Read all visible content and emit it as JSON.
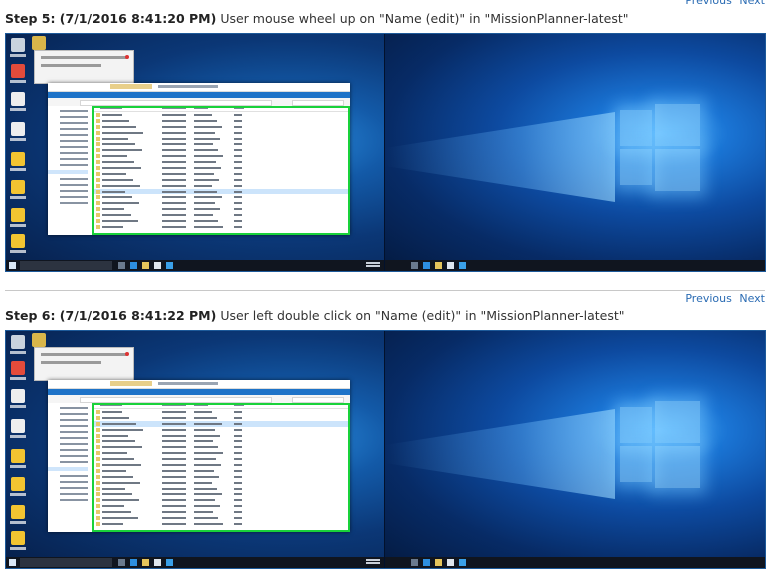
{
  "nav": {
    "previous": "Previous",
    "next": "Next"
  },
  "steps": [
    {
      "label": "Step 5: (7/1/2016 8:41:20 PM)",
      "description": "User mouse wheel up on \"Name (edit)\" in \"MissionPlanner-latest\""
    },
    {
      "label": "Step 6: (7/1/2016 8:41:22 PM)",
      "description": "User left double click on \"Name (edit)\" in \"MissionPlanner-latest\""
    }
  ],
  "colors": {
    "link": "#2a6bb3",
    "highlight": "#19d23a",
    "desktop": "#0b3776",
    "explorer_ribbon": "#1e73c8"
  },
  "icons": [
    "recycle-bin-icon",
    "folder-icon",
    "shortcut-icon",
    "windows-start-icon",
    "edge-icon",
    "file-explorer-icon",
    "store-icon"
  ]
}
